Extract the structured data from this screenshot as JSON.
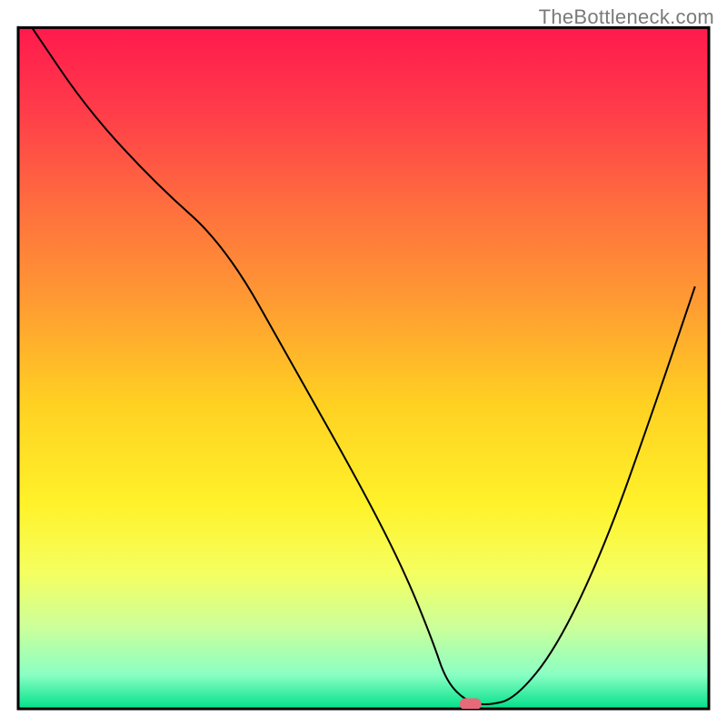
{
  "attribution": "TheBottleneck.com",
  "chart_data": {
    "type": "line",
    "title": "",
    "xlabel": "",
    "ylabel": "",
    "xlim": [
      0,
      100
    ],
    "ylim": [
      0,
      100
    ],
    "legend": false,
    "grid": false,
    "background_gradient": {
      "stops": [
        {
          "offset": 0.0,
          "color": "#ff1a4d"
        },
        {
          "offset": 0.12,
          "color": "#ff3b4a"
        },
        {
          "offset": 0.25,
          "color": "#ff6a3f"
        },
        {
          "offset": 0.4,
          "color": "#ff9a33"
        },
        {
          "offset": 0.55,
          "color": "#ffd022"
        },
        {
          "offset": 0.7,
          "color": "#fff22a"
        },
        {
          "offset": 0.8,
          "color": "#f5ff60"
        },
        {
          "offset": 0.88,
          "color": "#ccff9a"
        },
        {
          "offset": 0.95,
          "color": "#8affc4"
        },
        {
          "offset": 1.0,
          "color": "#00e08a"
        }
      ]
    },
    "series": [
      {
        "name": "bottleneck-curve",
        "color": "#000000",
        "width": 2,
        "x": [
          2,
          10,
          20,
          30,
          40,
          50,
          56,
          60,
          62,
          65,
          68,
          72,
          78,
          85,
          92,
          98
        ],
        "y": [
          100,
          88,
          77,
          68,
          50,
          32,
          20,
          10,
          4,
          1,
          0.5,
          1.5,
          9,
          24,
          44,
          62
        ]
      }
    ],
    "marker": {
      "name": "optimal-point",
      "x": 65.5,
      "y": 0.7,
      "width_pct": 3.0,
      "height_pct": 1.6,
      "color": "#e66a7a"
    },
    "axes": {
      "color": "#000000",
      "width": 3,
      "left": 2.5,
      "right": 97.5,
      "top": 3.8,
      "bottom": 97.5
    }
  }
}
